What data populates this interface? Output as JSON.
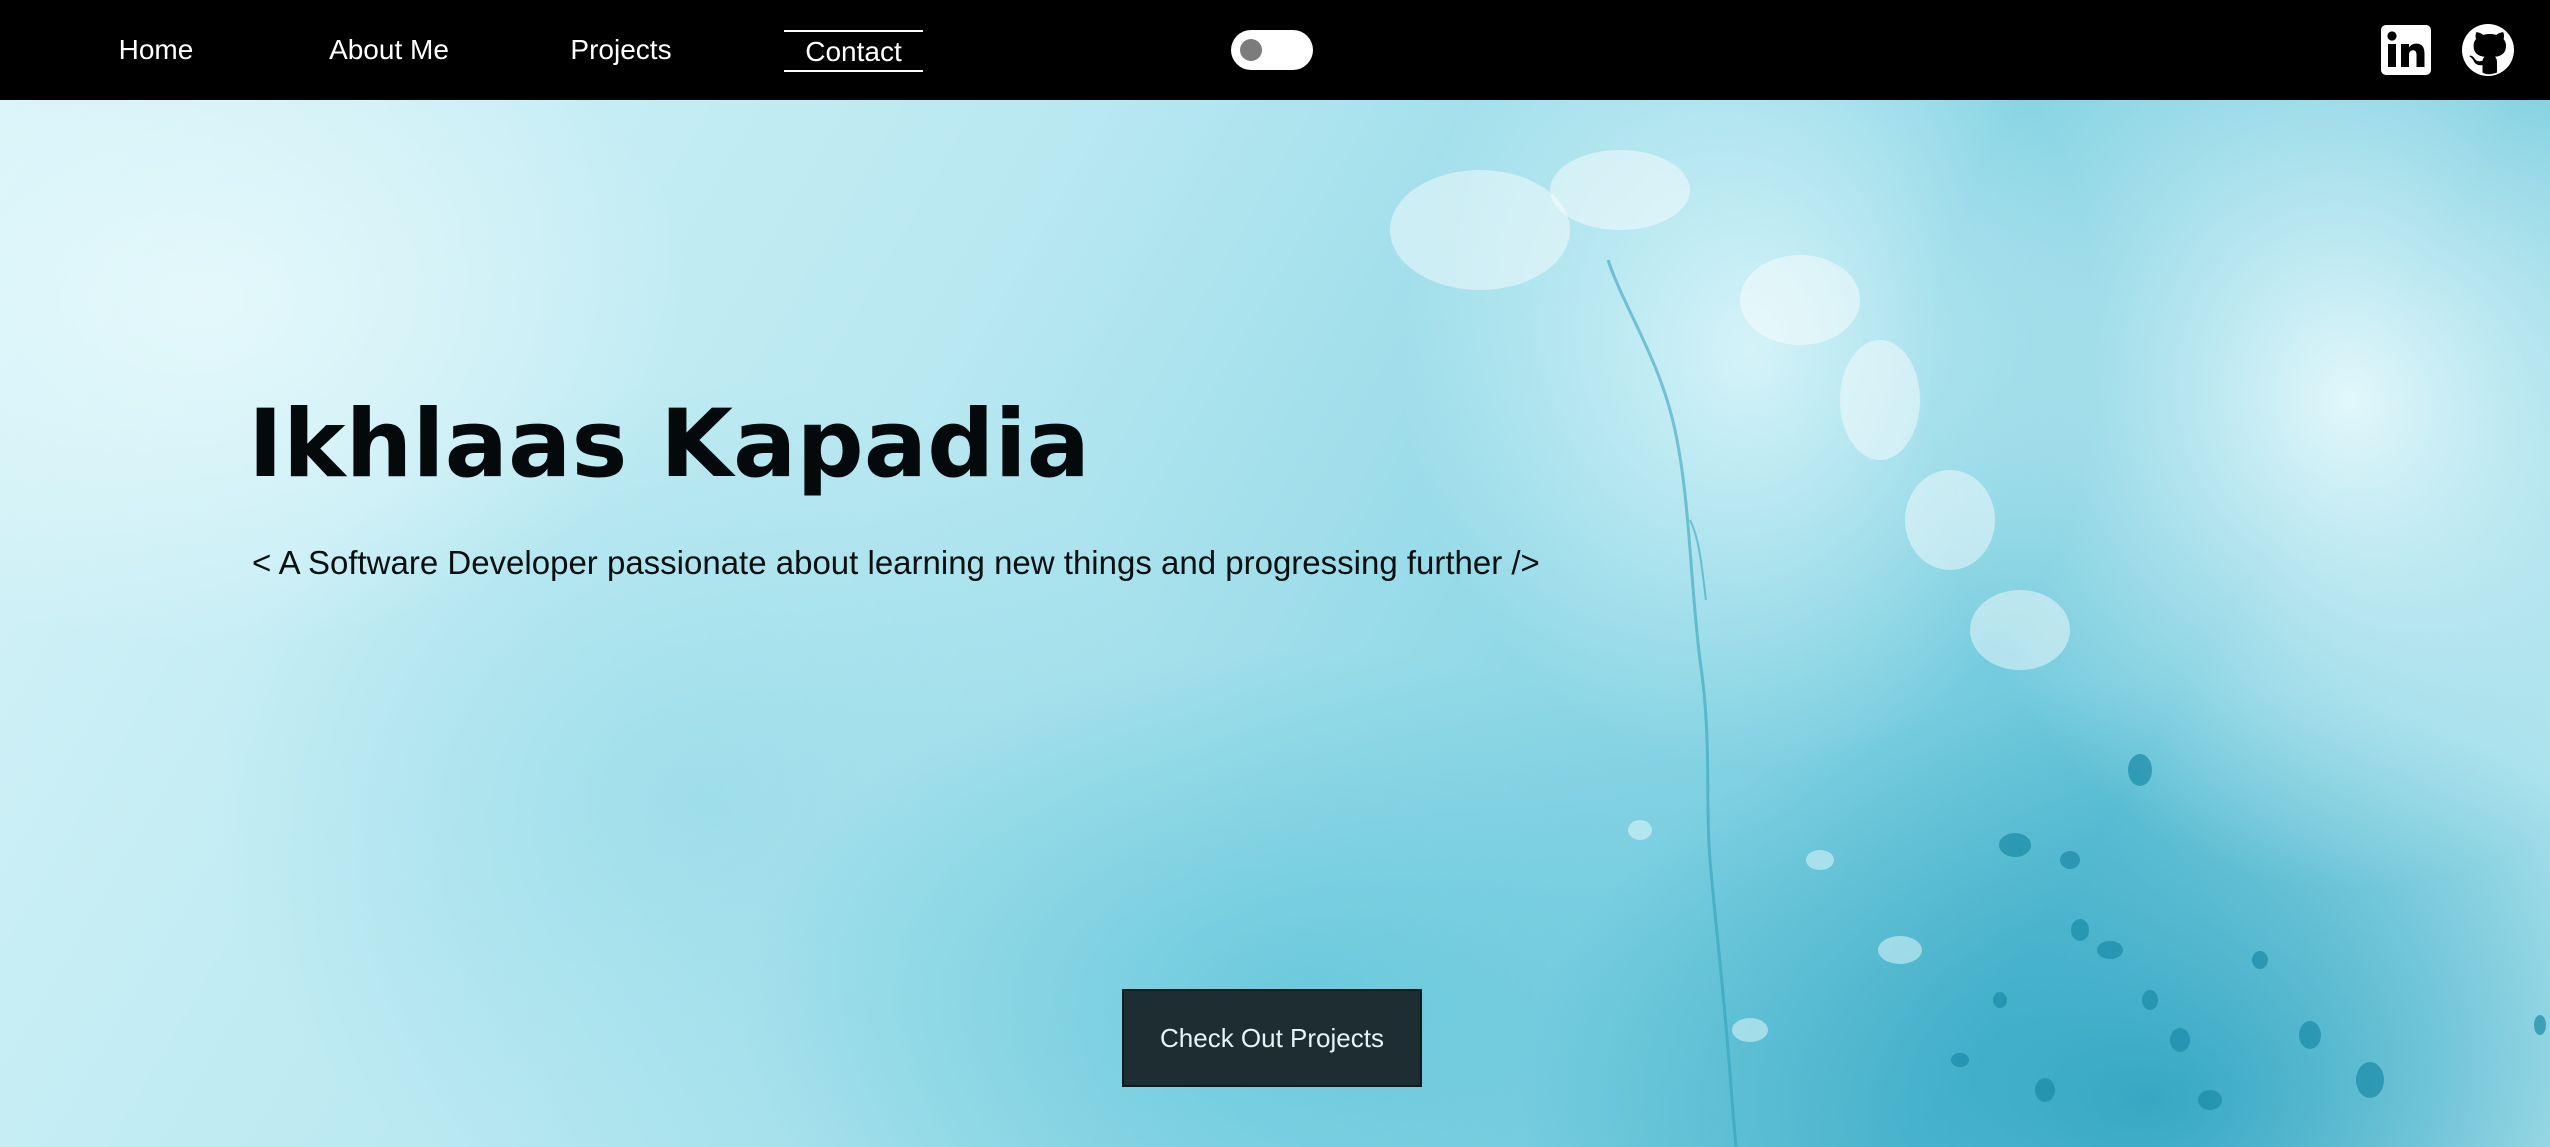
{
  "nav": {
    "links": [
      {
        "label": "Home"
      },
      {
        "label": "About Me"
      },
      {
        "label": "Projects"
      },
      {
        "label": "Contact",
        "active": true
      }
    ],
    "theme_toggle": {
      "state": "off",
      "icon": "toggle-switch-icon"
    },
    "social": [
      {
        "name": "LinkedIn",
        "icon": "linkedin-icon"
      },
      {
        "name": "GitHub",
        "icon": "github-icon"
      }
    ]
  },
  "hero": {
    "name": "Ikhlaas Kapadia",
    "tagline": "< A Software Developer passionate about learning new things and progressing further />",
    "cta_label": "Check Out Projects"
  },
  "colors": {
    "navbar_bg": "#000000",
    "nav_text": "#ffffff",
    "hero_bg": "#9fdde9",
    "heading_text": "#040a0c",
    "button_bg": "#1d2d32",
    "button_text": "#e4f4f7"
  }
}
